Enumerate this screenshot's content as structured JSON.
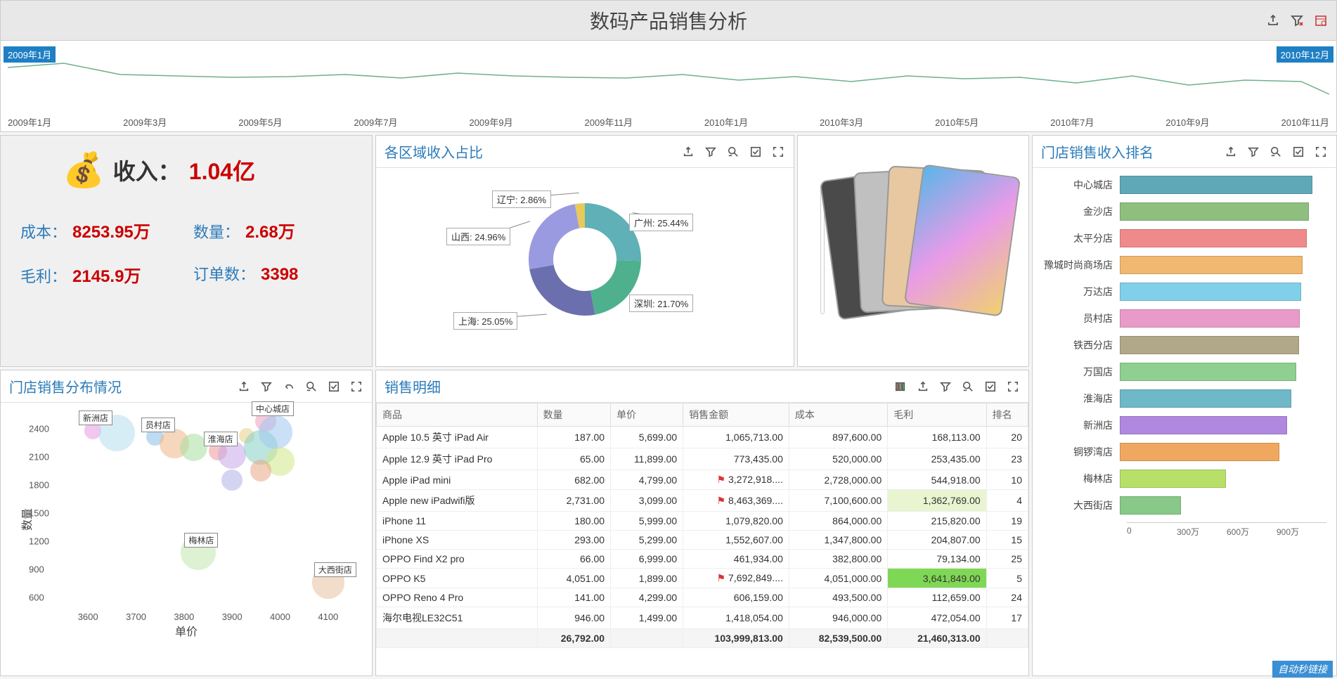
{
  "title": "数码产品销售分析",
  "timeline": {
    "start_label": "2009年1月",
    "end_label": "2010年12月",
    "ticks": [
      "2009年1月",
      "2009年3月",
      "2009年5月",
      "2009年7月",
      "2009年9月",
      "2009年11月",
      "2010年1月",
      "2010年3月",
      "2010年5月",
      "2010年7月",
      "2010年9月",
      "2010年11月"
    ]
  },
  "kpi": {
    "income_label": "收入：",
    "income_value": "1.04亿",
    "cost_label": "成本：",
    "cost_value": "8253.95万",
    "qty_label": "数量：",
    "qty_value": "2.68万",
    "profit_label": "毛利：",
    "profit_value": "2145.9万",
    "orders_label": "订单数：",
    "orders_value": "3398"
  },
  "pie": {
    "title": "各区域收入占比",
    "slices": [
      {
        "name": "广州",
        "pct": 25.44,
        "color": "#5fb0b7"
      },
      {
        "name": "深圳",
        "pct": 21.7,
        "color": "#4fb08d"
      },
      {
        "name": "上海",
        "pct": 25.05,
        "color": "#6b6fae"
      },
      {
        "name": "山西",
        "pct": 24.96,
        "color": "#9a9ae0"
      },
      {
        "name": "辽宁",
        "pct": 2.86,
        "color": "#e8c95b"
      }
    ]
  },
  "scatter": {
    "title": "门店销售分布情况",
    "xlabel": "单价",
    "ylabel": "数量",
    "x_ticks": [
      3600,
      3700,
      3800,
      3900,
      4000,
      4100
    ],
    "y_ticks": [
      600,
      900,
      1200,
      1500,
      1800,
      2100,
      2400
    ],
    "labeled": [
      {
        "name": "新洲店",
        "x": 3610,
        "y": 2380
      },
      {
        "name": "员村店",
        "x": 3740,
        "y": 2310
      },
      {
        "name": "淮海店",
        "x": 3870,
        "y": 2160
      },
      {
        "name": "中心城店",
        "x": 3970,
        "y": 2480
      },
      {
        "name": "梅林店",
        "x": 3830,
        "y": 1080
      },
      {
        "name": "大西街店",
        "x": 4100,
        "y": 760
      }
    ]
  },
  "detail": {
    "title": "销售明细",
    "headers": [
      "商品",
      "数量",
      "单价",
      "销售金额",
      "成本",
      "毛利",
      "排名"
    ],
    "rows": [
      {
        "c": [
          "Apple 10.5 英寸 iPad Air",
          "187.00",
          "5,699.00",
          "1,065,713.00",
          "897,600.00",
          "168,113.00",
          "20"
        ]
      },
      {
        "c": [
          "Apple 12.9 英寸 iPad Pro",
          "65.00",
          "11,899.00",
          "773,435.00",
          "520,000.00",
          "253,435.00",
          "23"
        ]
      },
      {
        "c": [
          "Apple iPad mini",
          "682.00",
          "4,799.00",
          "3,272,918....",
          "2,728,000.00",
          "544,918.00",
          "10"
        ],
        "flag": 3
      },
      {
        "c": [
          "Apple new iPadwifi版",
          "2,731.00",
          "3,099.00",
          "8,463,369....",
          "7,100,600.00",
          "1,362,769.00",
          "4"
        ],
        "flag": 3,
        "hl": 5
      },
      {
        "c": [
          "iPhone 11",
          "180.00",
          "5,999.00",
          "1,079,820.00",
          "864,000.00",
          "215,820.00",
          "19"
        ]
      },
      {
        "c": [
          "iPhone XS",
          "293.00",
          "5,299.00",
          "1,552,607.00",
          "1,347,800.00",
          "204,807.00",
          "15"
        ]
      },
      {
        "c": [
          "OPPO Find X2 pro",
          "66.00",
          "6,999.00",
          "461,934.00",
          "382,800.00",
          "79,134.00",
          "25"
        ]
      },
      {
        "c": [
          "OPPO K5",
          "4,051.00",
          "1,899.00",
          "7,692,849....",
          "4,051,000.00",
          "3,641,849.00",
          "5"
        ],
        "flag": 3,
        "hlg": 5
      },
      {
        "c": [
          "OPPO Reno 4 Pro",
          "141.00",
          "4,299.00",
          "606,159.00",
          "493,500.00",
          "112,659.00",
          "24"
        ]
      },
      {
        "c": [
          "海尔电视LE32C51",
          "946.00",
          "1,499.00",
          "1,418,054.00",
          "946,000.00",
          "472,054.00",
          "17"
        ]
      }
    ],
    "footer": [
      "",
      "26,792.00",
      "",
      "103,999,813.00",
      "82,539,500.00",
      "21,460,313.00",
      ""
    ]
  },
  "ranking": {
    "title": "门店销售收入排名",
    "max": 1000,
    "axis": [
      "0",
      "300万",
      "600万",
      "900万"
    ],
    "rows": [
      {
        "name": "中心城店",
        "val": 980,
        "color": "#5fa8b8"
      },
      {
        "name": "金沙店",
        "val": 960,
        "color": "#8fbf7f"
      },
      {
        "name": "太平分店",
        "val": 950,
        "color": "#f08a8a"
      },
      {
        "name": "豫城时尚商场店",
        "val": 930,
        "color": "#f0b870"
      },
      {
        "name": "万达店",
        "val": 920,
        "color": "#7fd0e8"
      },
      {
        "name": "员村店",
        "val": 915,
        "color": "#e89bc8"
      },
      {
        "name": "铁西分店",
        "val": 910,
        "color": "#b0a888"
      },
      {
        "name": "万国店",
        "val": 895,
        "color": "#8fcf8f"
      },
      {
        "name": "淮海店",
        "val": 870,
        "color": "#6fb8c8"
      },
      {
        "name": "新洲店",
        "val": 850,
        "color": "#b088e0"
      },
      {
        "name": "铜锣湾店",
        "val": 810,
        "color": "#f0a860"
      },
      {
        "name": "梅林店",
        "val": 540,
        "color": "#b8e068"
      },
      {
        "name": "大西街店",
        "val": 310,
        "color": "#88c888"
      }
    ]
  },
  "watermark": "自动秒链接",
  "chart_data": [
    {
      "type": "line",
      "title": "timeline",
      "x": [
        "2009-01",
        "2009-02",
        "2009-03",
        "2009-04",
        "2009-05",
        "2009-06",
        "2009-07",
        "2009-08",
        "2009-09",
        "2009-10",
        "2009-11",
        "2009-12",
        "2010-01",
        "2010-02",
        "2010-03",
        "2010-04",
        "2010-05",
        "2010-06",
        "2010-07",
        "2010-08",
        "2010-09",
        "2010-10",
        "2010-11",
        "2010-12"
      ],
      "series": [
        {
          "name": "trend",
          "values": [
            62,
            50,
            48,
            47,
            46,
            50,
            45,
            52,
            48,
            46,
            45,
            50,
            42,
            47,
            40,
            48,
            44,
            46,
            38,
            48,
            35,
            42,
            40,
            25
          ]
        }
      ],
      "xlabel": "",
      "ylabel": ""
    },
    {
      "type": "pie",
      "title": "各区域收入占比",
      "categories": [
        "广州",
        "深圳",
        "上海",
        "山西",
        "辽宁"
      ],
      "values": [
        25.44,
        21.7,
        25.05,
        24.96,
        2.86
      ]
    },
    {
      "type": "scatter",
      "title": "门店销售分布情况",
      "xlabel": "单价",
      "ylabel": "数量",
      "xlim": [
        3550,
        4150
      ],
      "ylim": [
        500,
        2600
      ],
      "series": [
        {
          "name": "stores",
          "points": [
            [
              3610,
              2380
            ],
            [
              3660,
              2350
            ],
            [
              3740,
              2310
            ],
            [
              3780,
              2240
            ],
            [
              3820,
              2200
            ],
            [
              3870,
              2160
            ],
            [
              3900,
              2120
            ],
            [
              3930,
              2320
            ],
            [
              3960,
              2200
            ],
            [
              3970,
              2480
            ],
            [
              3990,
              2360
            ],
            [
              4000,
              2050
            ],
            [
              3960,
              1950
            ],
            [
              3900,
              1850
            ],
            [
              3830,
              1080
            ],
            [
              4100,
              760
            ]
          ]
        }
      ]
    },
    {
      "type": "bar",
      "title": "门店销售收入排名",
      "xlabel": "",
      "ylabel": "",
      "categories": [
        "中心城店",
        "金沙店",
        "太平分店",
        "豫城时尚商场店",
        "万达店",
        "员村店",
        "铁西分店",
        "万国店",
        "淮海店",
        "新洲店",
        "铜锣湾店",
        "梅林店",
        "大西街店"
      ],
      "values": [
        980,
        960,
        950,
        930,
        920,
        915,
        910,
        895,
        870,
        850,
        810,
        540,
        310
      ],
      "ylim": [
        0,
        1000
      ]
    },
    {
      "type": "table",
      "title": "销售明细",
      "headers": [
        "商品",
        "数量",
        "单价",
        "销售金额",
        "成本",
        "毛利",
        "排名"
      ],
      "rows": [
        [
          "Apple 10.5 英寸 iPad Air",
          187,
          5699,
          1065713,
          897600,
          168113,
          20
        ],
        [
          "Apple 12.9 英寸 iPad Pro",
          65,
          11899,
          773435,
          520000,
          253435,
          23
        ],
        [
          "Apple iPad mini",
          682,
          4799,
          3272918,
          2728000,
          544918,
          10
        ],
        [
          "Apple new iPadwifi版",
          2731,
          3099,
          8463369,
          7100600,
          1362769,
          4
        ],
        [
          "iPhone 11",
          180,
          5999,
          1079820,
          864000,
          215820,
          19
        ],
        [
          "iPhone XS",
          293,
          5299,
          1552607,
          1347800,
          204807,
          15
        ],
        [
          "OPPO Find X2 pro",
          66,
          6999,
          461934,
          382800,
          79134,
          25
        ],
        [
          "OPPO K5",
          4051,
          1899,
          7692849,
          4051000,
          3641849,
          5
        ],
        [
          "OPPO Reno 4 Pro",
          141,
          4299,
          606159,
          493500,
          112659,
          24
        ],
        [
          "海尔电视LE32C51",
          946,
          1499,
          1418054,
          946000,
          472054,
          17
        ]
      ],
      "totals": [
        "",
        26792,
        "",
        103999813,
        82539500,
        21460313,
        ""
      ]
    }
  ]
}
